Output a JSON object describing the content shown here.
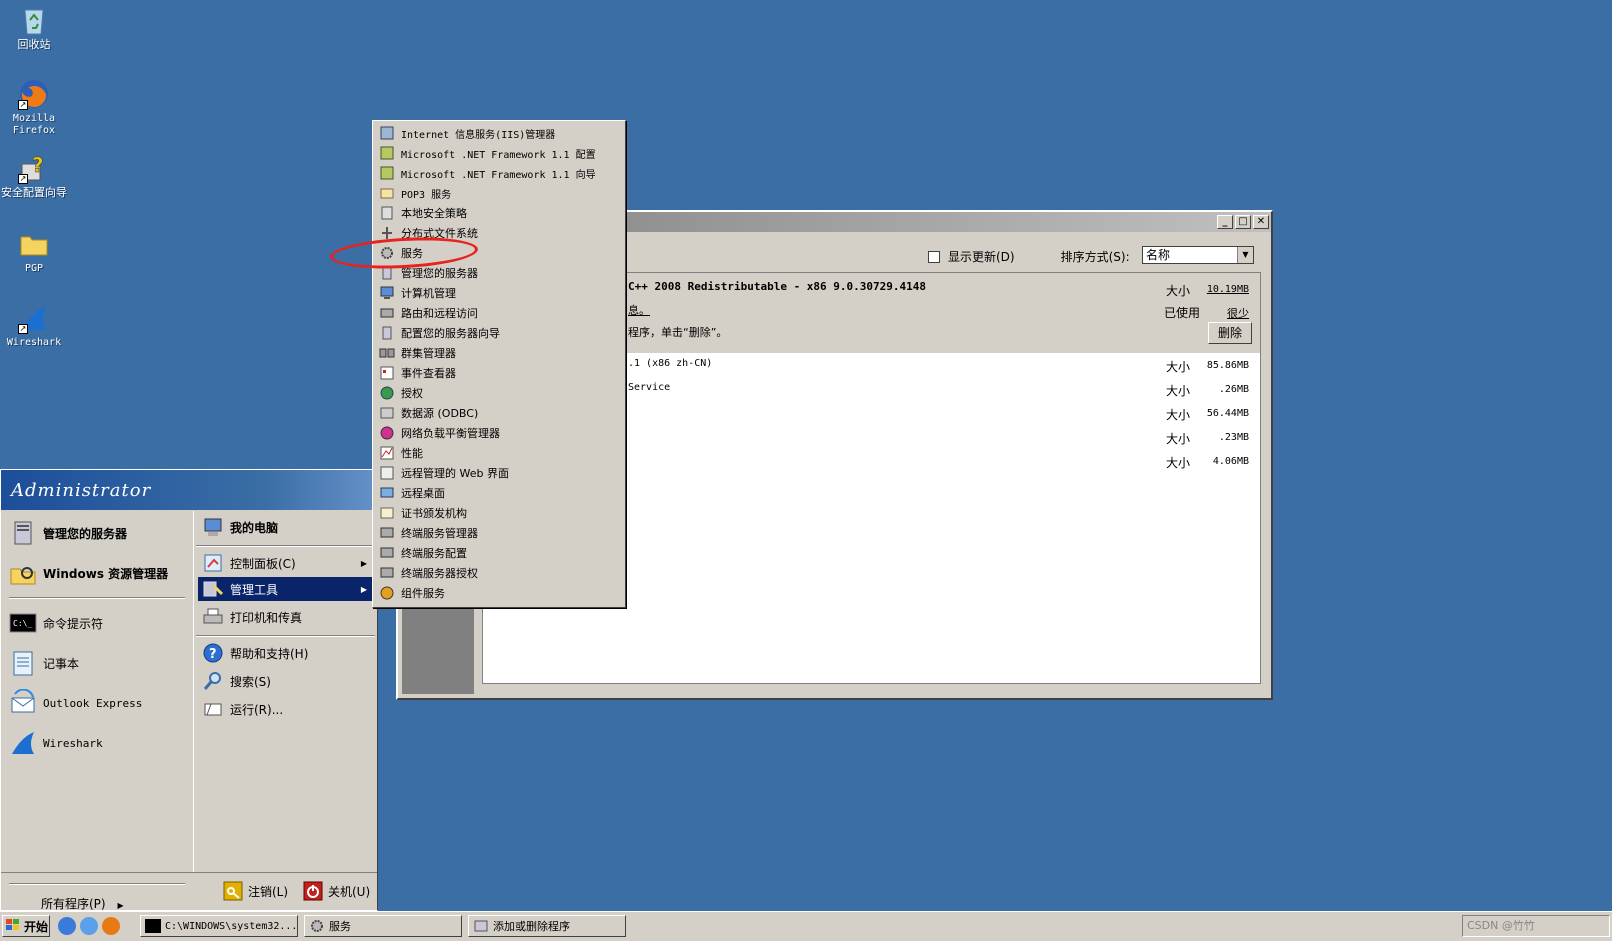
{
  "desktop": {
    "icons": [
      {
        "label": "回收站",
        "icon": "recycle-bin-icon"
      },
      {
        "label": "Mozilla Firefox",
        "icon": "firefox-icon"
      },
      {
        "label": "安全配置向导",
        "icon": "security-wizard-icon"
      },
      {
        "label": "PGP",
        "icon": "folder-icon"
      },
      {
        "label": "Wireshark",
        "icon": "wireshark-icon"
      }
    ]
  },
  "window": {
    "show_updates": "显示更新(D)",
    "sort_by": "排序方式(S):",
    "sort_value": "名称",
    "selected": {
      "name": "C++ 2008 Redistributable - x86 9.0.30729.4148",
      "sub": "息。",
      "hint": "程序，单击“删除”。",
      "size_label": "大小",
      "size_value": "10.19MB",
      "used_label": "已使用",
      "used_value": "很少",
      "remove_button": "删除"
    },
    "rows": [
      {
        "text": ".1 (x86 zh-CN)",
        "size_label": "大小",
        "size": "85.86MB"
      },
      {
        "text": "Service",
        "size_label": "大小",
        "size": ".26MB"
      },
      {
        "text": "",
        "size_label": "大小",
        "size": "56.44MB"
      },
      {
        "text": "",
        "size_label": "大小",
        "size": ".23MB"
      },
      {
        "text": "",
        "size_label": "大小",
        "size": "4.06MB"
      }
    ]
  },
  "start_menu": {
    "user": "Administrator",
    "left_items": [
      "管理您的服务器",
      "Windows 资源管理器",
      "命令提示符",
      "记事本",
      "Outlook Express",
      "Wireshark"
    ],
    "all_programs": "所有程序(P)",
    "right_items": [
      "我的电脑",
      "控制面板(C)",
      "管理工具",
      "打印机和传真",
      "帮助和支持(H)",
      "搜索(S)",
      "运行(R)..."
    ],
    "logoff": "注销(L)",
    "shutdown": "关机(U)"
  },
  "admin_tools": [
    "Internet 信息服务(IIS)管理器",
    "Microsoft .NET Framework 1.1 配置",
    "Microsoft .NET Framework 1.1 向导",
    "POP3 服务",
    "本地安全策略",
    "分布式文件系统",
    "服务",
    "管理您的服务器",
    "计算机管理",
    "路由和远程访问",
    "配置您的服务器向导",
    "群集管理器",
    "事件查看器",
    "授权",
    "数据源 (ODBC)",
    "网络负载平衡管理器",
    "性能",
    "远程管理的 Web 界面",
    "远程桌面",
    "证书颁发机构",
    "终端服务管理器",
    "终端服务配置",
    "终端服务器授权",
    "组件服务"
  ],
  "taskbar": {
    "start": "开始",
    "tasks": [
      "C:\\WINDOWS\\system32...",
      "服务",
      "添加或删除程序"
    ],
    "tray_text": "CSDN @竹竹"
  }
}
